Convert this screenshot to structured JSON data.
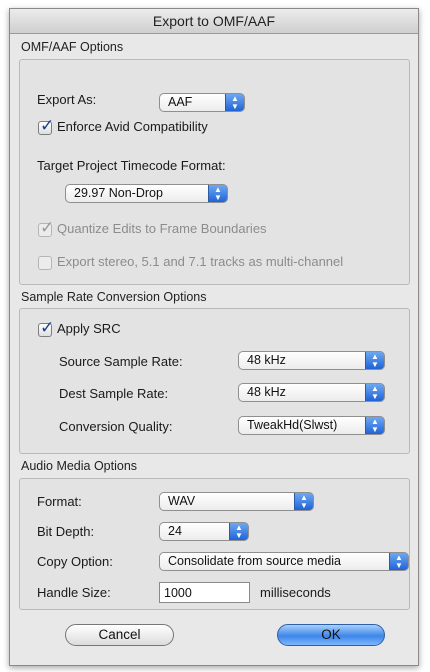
{
  "window": {
    "title": "Export to OMF/AAF"
  },
  "omf": {
    "section_title": "OMF/AAF Options",
    "export_as_label": "Export As:",
    "export_as_value": "AAF",
    "enforce_avid_label": "Enforce Avid Compatibility",
    "enforce_avid_checked": true,
    "timecode_label": "Target Project Timecode Format:",
    "timecode_value": "29.97 Non-Drop",
    "quantize_label": "Quantize Edits to Frame Boundaries",
    "quantize_checked": true,
    "multichannel_label": "Export stereo, 5.1 and 7.1 tracks as multi-channel",
    "multichannel_checked": false
  },
  "src": {
    "section_title": "Sample Rate Conversion Options",
    "apply_src_label": "Apply SRC",
    "apply_src_checked": true,
    "source_rate_label": "Source Sample Rate:",
    "source_rate_value": "48 kHz",
    "dest_rate_label": "Dest Sample Rate:",
    "dest_rate_value": "48 kHz",
    "quality_label": "Conversion Quality:",
    "quality_value": "TweakHd(Slwst)"
  },
  "audio": {
    "section_title": "Audio Media Options",
    "format_label": "Format:",
    "format_value": "WAV",
    "bitdepth_label": "Bit Depth:",
    "bitdepth_value": "24",
    "copy_label": "Copy Option:",
    "copy_value": "Consolidate from source media",
    "handle_label": "Handle Size:",
    "handle_value": "1000",
    "handle_unit": "milliseconds"
  },
  "buttons": {
    "cancel": "Cancel",
    "ok": "OK"
  },
  "icons": {
    "popup_arrows": "up-down-arrows-icon",
    "checkmark": "checkmark-icon"
  },
  "colors": {
    "accent": "#3d86e8",
    "window_bg": "#e8e8e8"
  }
}
